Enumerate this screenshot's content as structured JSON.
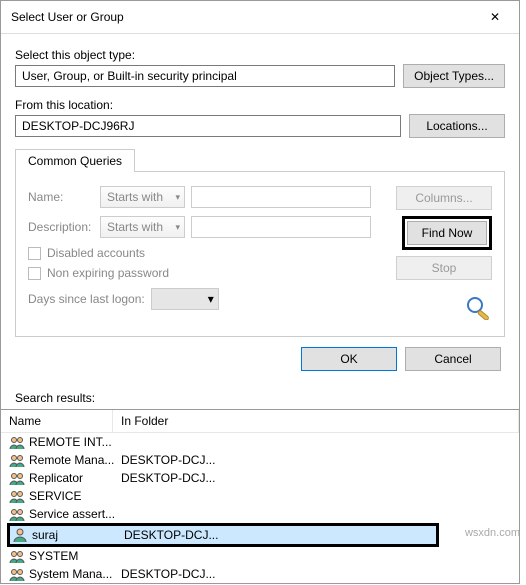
{
  "title": "Select User or Group",
  "labels": {
    "object_type": "Select this object type:",
    "from_location": "From this location:",
    "common_queries": "Common Queries",
    "name": "Name:",
    "description": "Description:",
    "disabled": "Disabled accounts",
    "nonexpire": "Non expiring password",
    "days": "Days since last logon:",
    "search_results": "Search results:"
  },
  "fields": {
    "object_type_value": "User, Group, or Built-in security principal",
    "location_value": "DESKTOP-DCJ96RJ",
    "name_match": "Starts with",
    "desc_match": "Starts with"
  },
  "buttons": {
    "object_types": "Object Types...",
    "locations": "Locations...",
    "columns": "Columns...",
    "find_now": "Find Now",
    "stop": "Stop",
    "ok": "OK",
    "cancel": "Cancel"
  },
  "columns": {
    "name": "Name",
    "folder": "In Folder"
  },
  "results": [
    {
      "name": "REMOTE INT...",
      "folder": "",
      "type": "group"
    },
    {
      "name": "Remote Mana...",
      "folder": "DESKTOP-DCJ...",
      "type": "group"
    },
    {
      "name": "Replicator",
      "folder": "DESKTOP-DCJ...",
      "type": "group"
    },
    {
      "name": "SERVICE",
      "folder": "",
      "type": "group"
    },
    {
      "name": "Service assert...",
      "folder": "",
      "type": "group"
    },
    {
      "name": "suraj",
      "folder": "DESKTOP-DCJ...",
      "type": "user",
      "selected": true,
      "highlighted": true
    },
    {
      "name": "SYSTEM",
      "folder": "",
      "type": "group"
    },
    {
      "name": "System Mana...",
      "folder": "DESKTOP-DCJ...",
      "type": "group"
    }
  ],
  "watermark": "wsxdn.com"
}
